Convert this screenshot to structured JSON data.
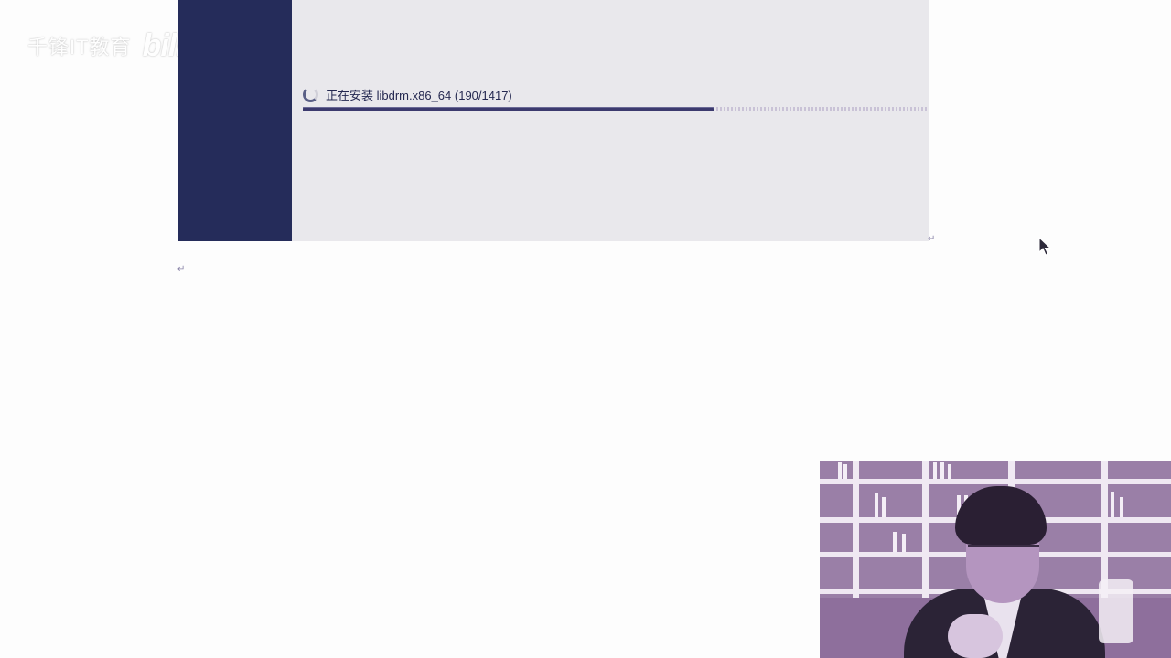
{
  "watermark": {
    "text": "千锋IT教育",
    "logo": "bilibili"
  },
  "installer": {
    "status_text": "正在安装 libdrm.x86_64 (190/1417)",
    "progress": {
      "current": 190,
      "total": 1417,
      "fraction": 0.655
    },
    "colors": {
      "sidebar": "#252c5a",
      "panel": "#e9e8ec",
      "progress": "#3c3a6e"
    }
  },
  "document": {
    "paragraph_mark": "↵"
  },
  "icons": {
    "spinner": "loading-spinner-icon",
    "cursor": "mouse-pointer-icon"
  },
  "overlay": {
    "webcam": "presenter-video"
  }
}
